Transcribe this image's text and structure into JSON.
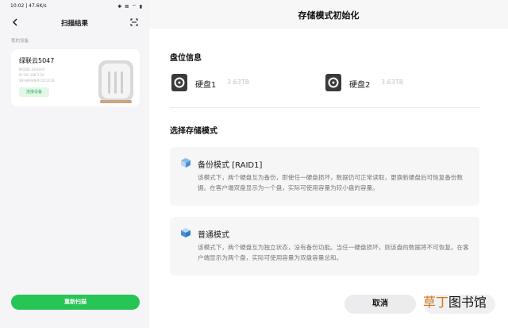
{
  "phone": {
    "status": {
      "time_speed": "10:02 | 47.6K/s",
      "icons": "✱ ⊠ ⌔ ▮"
    },
    "nav_title": "扫描结果",
    "section_label": "我的设备",
    "device": {
      "name": "绿联云5047",
      "model": "MODEL:DH2600",
      "ip": "IP:192.168.7.50",
      "sn": "SN:H6M4N4FC0C3C3E",
      "connect_label": "连接设备"
    },
    "rescan_label": "重新扫描"
  },
  "dialog": {
    "title": "存储模式初始化",
    "disk_section": "盘位信息",
    "disks": [
      {
        "name": "硬盘1",
        "size": "3.63TB"
      },
      {
        "name": "硬盘2",
        "size": "3.63TB"
      }
    ],
    "mode_section": "选择存储模式",
    "modes": [
      {
        "title": "备份模式 [RAID1]",
        "desc": "该模式下，两个硬盘互为备份，即使任一硬盘损坏，数据仍可正常读取，更换新硬盘后可恢复备份数据。在客户端双盘显示为一个盘，实际可使用容量为较小盘的容量。"
      },
      {
        "title": "普通模式",
        "desc": "该模式下，两个硬盘互为独立状态，没有备份功能。当任一硬盘损坏，则该盘的数据将不可恢复。在客户端显示为两个盘，实际可使用容量为双盘容量总和。"
      }
    ],
    "cancel_label": "取消"
  },
  "watermark": {
    "accent": "草丁",
    "rest": "图书馆"
  },
  "colors": {
    "green": "#27c456",
    "blue_icon": "#4a90d9"
  }
}
